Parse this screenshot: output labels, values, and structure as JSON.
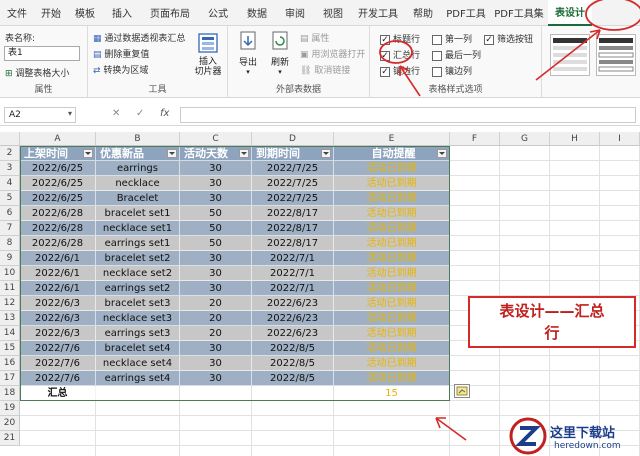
{
  "tabs": [
    "文件",
    "开始",
    "模板",
    "插入",
    "页面布局",
    "公式",
    "数据",
    "审阅",
    "视图",
    "开发工具",
    "帮助",
    "PDF工具",
    "PDF工具集",
    "表设计"
  ],
  "ribbon": {
    "props": {
      "name_label": "表名称:",
      "name_value": "表1",
      "resize": "调整表格大小",
      "group": "属性"
    },
    "tools": {
      "pivot": "通过数据透视表汇总",
      "dedupe": "删除重复值",
      "convert": "转换为区域",
      "slicer": "插入\n切片器",
      "group": "工具"
    },
    "external": {
      "export": "导出",
      "refresh": "刷新",
      "properties": "属性",
      "open_browser": "用浏览器打开",
      "unlink": "取消链接",
      "group": "外部表数据"
    },
    "style_opts": {
      "items": [
        {
          "label": "标题行",
          "checked": true
        },
        {
          "label": "第一列",
          "checked": false
        },
        {
          "label": "筛选按钮",
          "checked": true
        },
        {
          "label": "汇总行",
          "checked": true
        },
        {
          "label": "最后一列",
          "checked": false
        },
        {
          "label": "镶边行",
          "checked": true
        },
        {
          "label": "镶边列",
          "checked": false
        }
      ],
      "group": "表格样式选项"
    }
  },
  "formula_bar": {
    "cell_ref": "A2",
    "cancel": "✕",
    "confirm": "✓",
    "fx": "fx",
    "value": ""
  },
  "columns": [
    "A",
    "B",
    "C",
    "D",
    "E",
    "F",
    "G",
    "H",
    "I"
  ],
  "rows": [
    "2",
    "3",
    "4",
    "5",
    "6",
    "7",
    "8",
    "9",
    "10",
    "11",
    "12",
    "13",
    "14",
    "15",
    "16",
    "17",
    "18",
    "19",
    "20",
    "21"
  ],
  "table": {
    "headers": [
      "上架时间",
      "优惠新品",
      "活动天数",
      "到期时间",
      "自动提醒"
    ],
    "data": [
      [
        "2022/6/25",
        "earrings",
        "30",
        "2022/7/25",
        "活动已到期"
      ],
      [
        "2022/6/25",
        "necklace",
        "30",
        "2022/7/25",
        "活动已到期"
      ],
      [
        "2022/6/25",
        "Bracelet",
        "30",
        "2022/7/25",
        "活动已到期"
      ],
      [
        "2022/6/28",
        "bracelet set1",
        "50",
        "2022/8/17",
        "活动已到期"
      ],
      [
        "2022/6/28",
        "necklace set1",
        "50",
        "2022/8/17",
        "活动已到期"
      ],
      [
        "2022/6/28",
        "earrings set1",
        "50",
        "2022/8/17",
        "活动已到期"
      ],
      [
        "2022/6/1",
        "bracelet set2",
        "30",
        "2022/7/1",
        "活动已到期"
      ],
      [
        "2022/6/1",
        "necklace set2",
        "30",
        "2022/7/1",
        "活动已到期"
      ],
      [
        "2022/6/1",
        "earrings set2",
        "30",
        "2022/7/1",
        "活动已到期"
      ],
      [
        "2022/6/3",
        "bracelet set3",
        "20",
        "2022/6/23",
        "活动已到期"
      ],
      [
        "2022/6/3",
        "necklace set3",
        "20",
        "2022/6/23",
        "活动已到期"
      ],
      [
        "2022/6/3",
        "earrings set3",
        "20",
        "2022/6/23",
        "活动已到期"
      ],
      [
        "2022/7/6",
        "bracelet set4",
        "30",
        "2022/8/5",
        "活动已到期"
      ],
      [
        "2022/7/6",
        "necklace set4",
        "30",
        "2022/8/5",
        "活动已到期"
      ],
      [
        "2022/7/6",
        "earrings set4",
        "30",
        "2022/8/5",
        "活动已到期"
      ]
    ],
    "total_label": "汇总",
    "total_value": "15"
  },
  "annotation": {
    "line1": "表设计——汇总",
    "line2": "行"
  },
  "watermark": {
    "name": "这里下载站",
    "url": "heredown.com"
  },
  "colors": {
    "header": "#8ea4be",
    "band_a": "#9fb0c4",
    "band_b": "#c7c7c7",
    "warn_text": "#e8b400",
    "accent": "#1e6b3a",
    "annotation": "#d42a2a"
  }
}
